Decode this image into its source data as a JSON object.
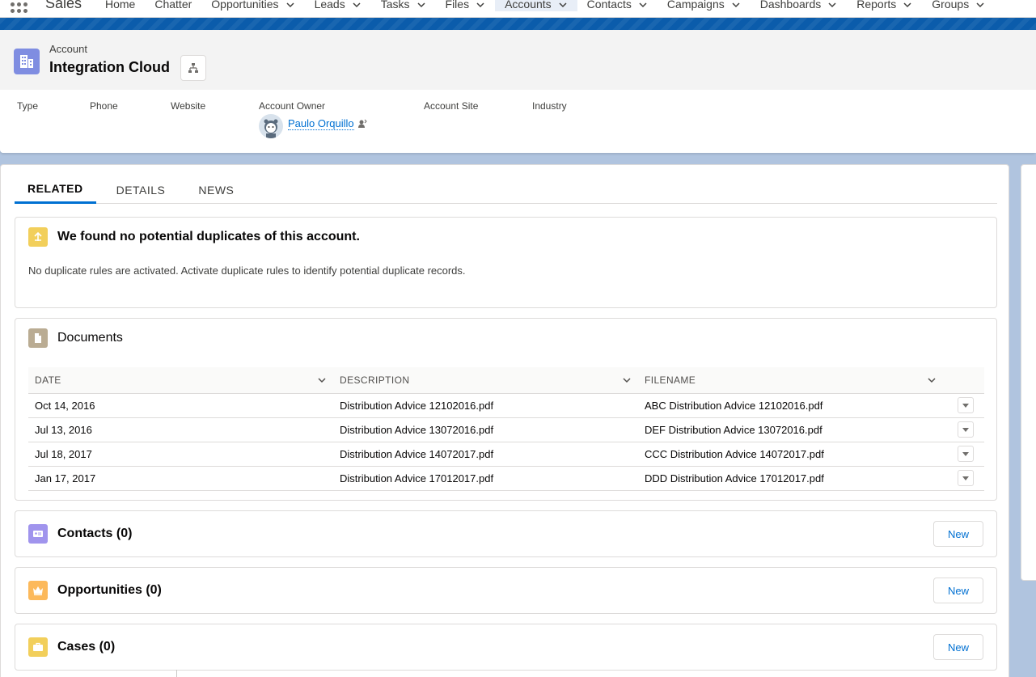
{
  "app": {
    "name": "Sales",
    "nav_items": [
      {
        "label": "Home",
        "has_menu": false
      },
      {
        "label": "Chatter",
        "has_menu": false
      },
      {
        "label": "Opportunities",
        "has_menu": true
      },
      {
        "label": "Leads",
        "has_menu": true
      },
      {
        "label": "Tasks",
        "has_menu": true
      },
      {
        "label": "Files",
        "has_menu": true
      },
      {
        "label": "Accounts",
        "has_menu": true,
        "active": true
      },
      {
        "label": "Contacts",
        "has_menu": true
      },
      {
        "label": "Campaigns",
        "has_menu": true
      },
      {
        "label": "Dashboards",
        "has_menu": true
      },
      {
        "label": "Reports",
        "has_menu": true
      },
      {
        "label": "Groups",
        "has_menu": true
      }
    ]
  },
  "record": {
    "entity_label": "Account",
    "name": "Integration Cloud",
    "fields": {
      "type_label": "Type",
      "phone_label": "Phone",
      "website_label": "Website",
      "owner_label": "Account Owner",
      "owner_name": "Paulo Orquillo",
      "site_label": "Account Site",
      "industry_label": "Industry"
    }
  },
  "tabs": [
    "RELATED",
    "DETAILS",
    "NEWS"
  ],
  "duplicates": {
    "title": "We found no potential duplicates of this account.",
    "message": "No duplicate rules are activated. Activate duplicate rules to identify potential duplicate records."
  },
  "documents": {
    "title": "Documents",
    "columns": [
      "DATE",
      "DESCRIPTION",
      "FILENAME"
    ],
    "rows": [
      [
        "Oct 14, 2016",
        "Distribution Advice 12102016.pdf",
        "ABC Distribution Advice 12102016.pdf"
      ],
      [
        "Jul 13, 2016",
        "Distribution Advice 13072016.pdf",
        "DEF Distribution Advice 13072016.pdf"
      ],
      [
        "Jul 18, 2017",
        "Distribution Advice 14072017.pdf",
        "CCC Distribution Advice 14072017.pdf"
      ],
      [
        "Jan 17, 2017",
        "Distribution Advice 17012017.pdf",
        "DDD Distribution Advice 17012017.pdf"
      ]
    ]
  },
  "related_lists": [
    {
      "title": "Contacts (0)",
      "button": "New",
      "icon": "contact-icon",
      "color": "#a094ed"
    },
    {
      "title": "Opportunities (0)",
      "button": "New",
      "icon": "crown-icon",
      "color": "#fcb95b"
    },
    {
      "title": "Cases (0)",
      "button": "New",
      "icon": "briefcase-icon",
      "color": "#f2cf5b"
    }
  ],
  "colors": {
    "brand_blue": "#0070d2",
    "account_icon": "#7f8de1",
    "duplicate_icon": "#f2cf5b",
    "document_icon": "#baac93"
  }
}
